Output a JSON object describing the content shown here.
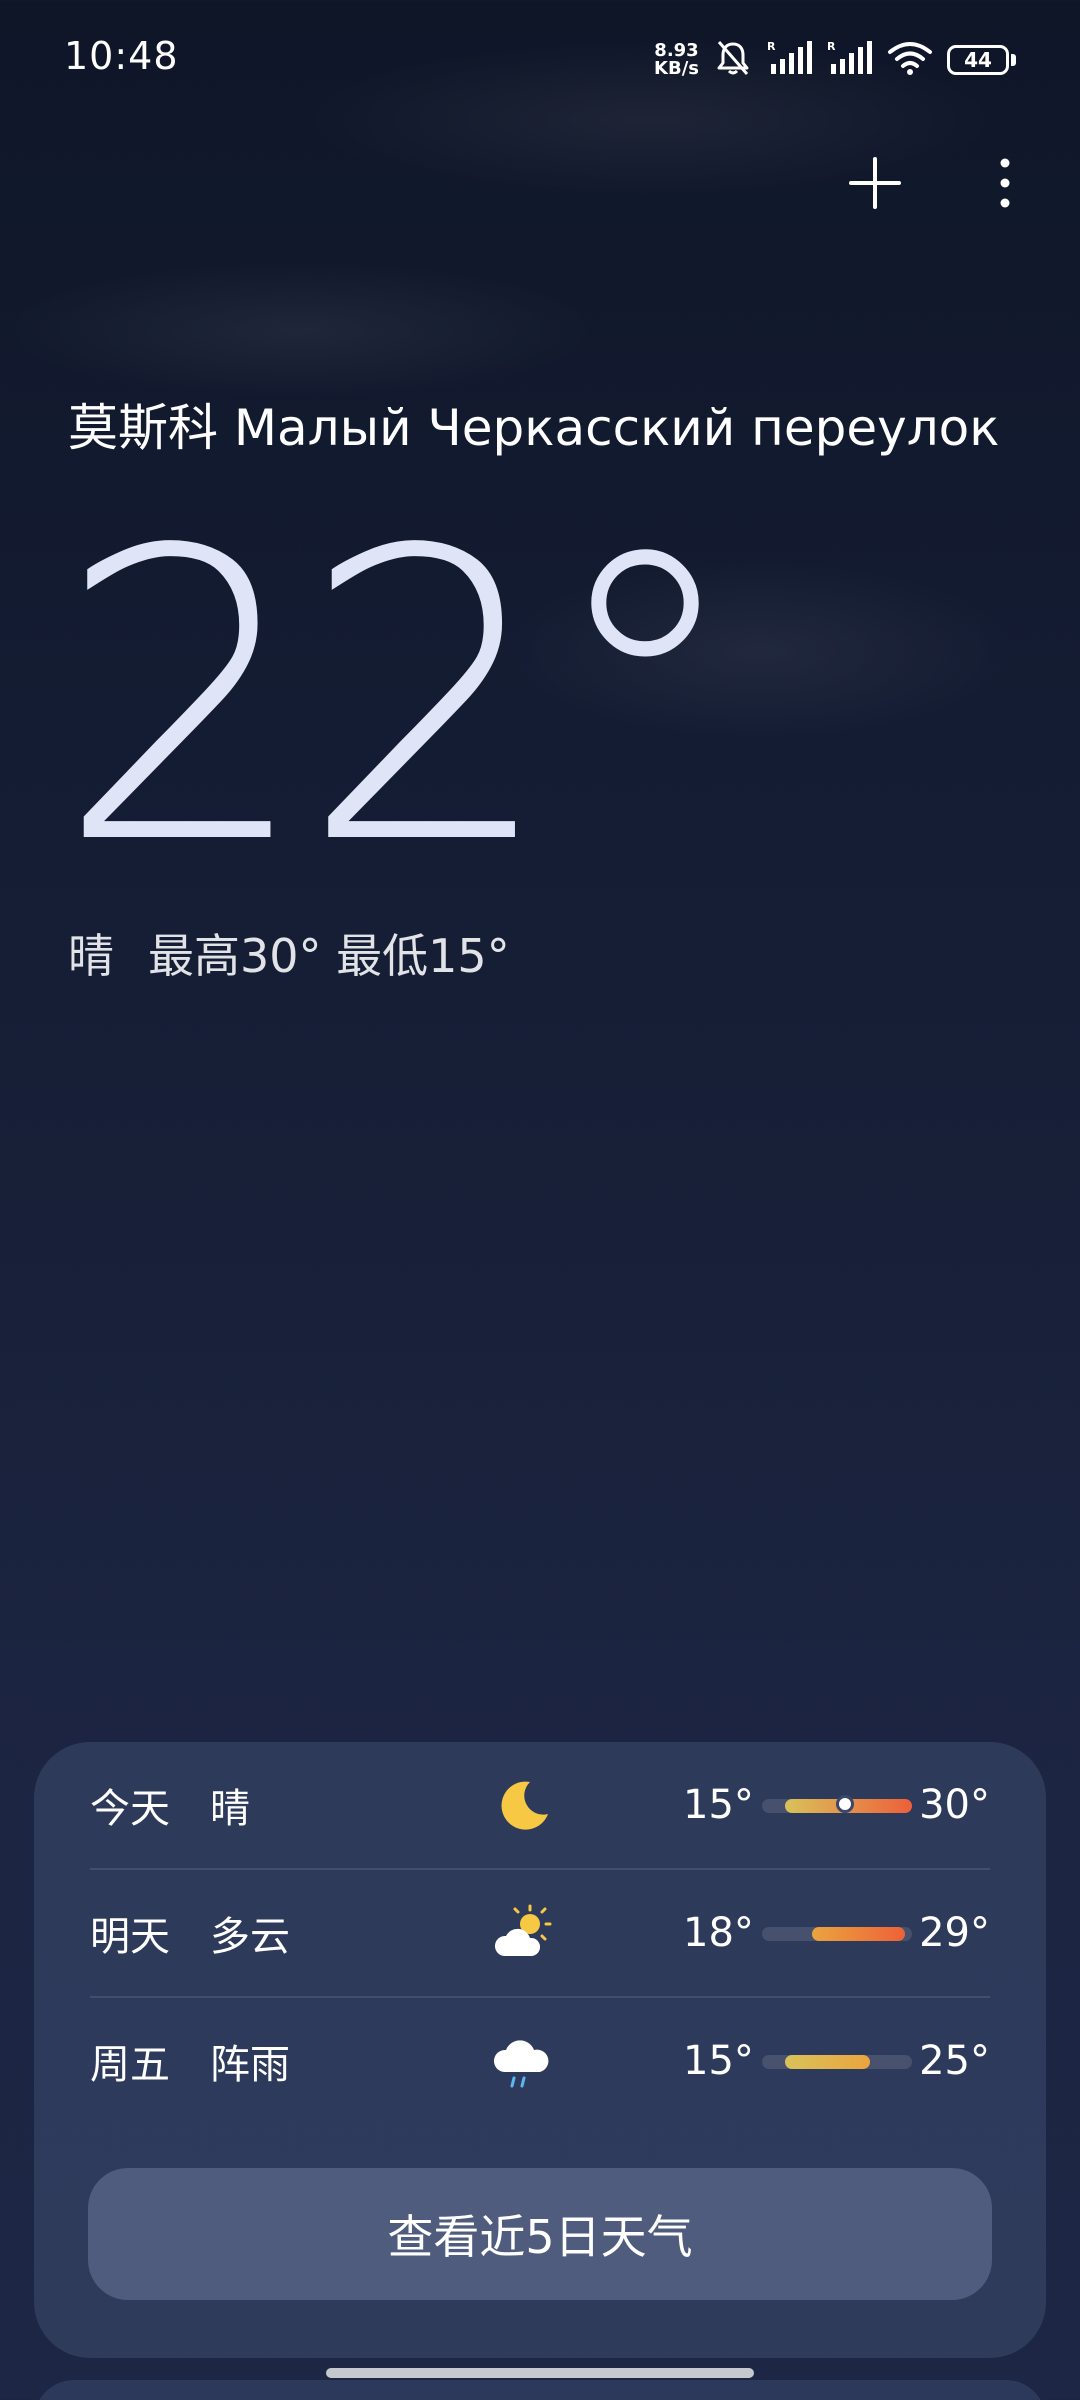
{
  "status_bar": {
    "time": "10:48",
    "net_speed_value": "8.93",
    "net_speed_unit": "KB/s",
    "battery_level": "44",
    "icons": [
      "mute-bell-icon",
      "signal-icon",
      "signal-icon",
      "wifi-icon",
      "battery-icon"
    ]
  },
  "toolbar": {
    "add_icon": "plus-icon",
    "menu_icon": "more-vert-icon"
  },
  "current": {
    "location": "莫斯科 Малый Черкасский переулок",
    "temperature": "22°",
    "condition": "晴",
    "high_low": "最高30° 最低15°"
  },
  "forecast": {
    "rows": [
      {
        "day": "今天",
        "condition": "晴",
        "icon": "moon-icon",
        "low": "15°",
        "high": "30°",
        "range_start": 0.15,
        "range_end": 1.0,
        "current_marker": 0.55,
        "gradient_from": "#d9c25a",
        "gradient_to": "#ee5f3a"
      },
      {
        "day": "明天",
        "condition": "多云",
        "icon": "partly-cloudy-icon",
        "low": "18°",
        "high": "29°",
        "range_start": 0.33,
        "range_end": 0.95,
        "gradient_from": "#eaa43f",
        "gradient_to": "#ee6138"
      },
      {
        "day": "周五",
        "condition": "阵雨",
        "icon": "rain-cloud-icon",
        "low": "15°",
        "high": "25°",
        "range_start": 0.15,
        "range_end": 0.72,
        "gradient_from": "#d9c25a",
        "gradient_to": "#eaa43f"
      }
    ],
    "button_label": "查看近5日天气"
  },
  "colors": {
    "background_top": "#0f1628",
    "background_bottom": "#1d2644",
    "card": "#3e4c70",
    "sun_yellow": "#f7c844",
    "rain_blue": "#5ab8f0"
  }
}
